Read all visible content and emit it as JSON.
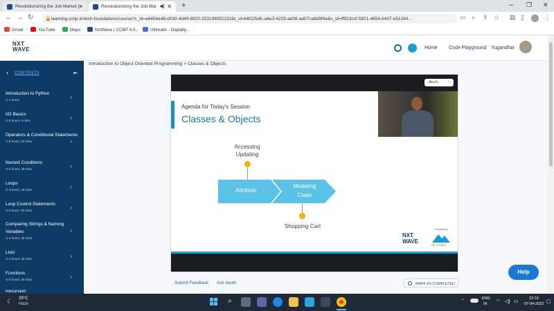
{
  "browser": {
    "tabs": [
      {
        "label": "Revolutionizing the Job Market |"
      },
      {
        "label": "Revolutionizing the Job Mar"
      }
    ],
    "new_tab": "+",
    "url": "learning.ccbp.in/tech-foundations/course?c_id=a6454e48-d030-4d49-8920-253198052232&t_id=b6025dfc-a6e3-4225-ad36-ad07ca8d9f4e&s_id=ff923ccf-5821-4854-b437-e51264...",
    "bookmarks": [
      {
        "label": "Gmail",
        "color": "#ea4335"
      },
      {
        "label": "YouTube",
        "color": "#ff0000"
      },
      {
        "label": "Maps",
        "color": "#34a853"
      },
      {
        "label": "NxtWave | CCBP 4.0...",
        "color": "#1f4c8f"
      },
      {
        "label": "Ultimatix - Digitally...",
        "color": "#4a6ee0"
      }
    ]
  },
  "header": {
    "logo_line1": "NXT",
    "logo_line2": "WAVE",
    "home": "Home",
    "code_playground": "Code Playground",
    "username": "Yugandhar"
  },
  "sidebar": {
    "contents_label": "CONTENTS",
    "items": [
      {
        "title": "Introduction to Python",
        "duration": "4 hours"
      },
      {
        "title": "I/O Basics",
        "duration": "5 hours, 5 mins"
      },
      {
        "title": "Operators & Conditional Statements",
        "duration": "8 hours, 20 mins"
      },
      {
        "title": "Nested Conditions",
        "duration": "5 hours, 35 mins"
      },
      {
        "title": "Loops",
        "duration": "9 hours, 15 mins"
      },
      {
        "title": "Loop Control Statements",
        "duration": "8 hours, 50 mins"
      },
      {
        "title": "Comparing Strings & Naming Variables",
        "duration": "4 hours, 45 mins"
      },
      {
        "title": "Lists",
        "duration": "3 hours, 40 mins"
      },
      {
        "title": "Functions",
        "duration": "8 hours, 50 mins"
      },
      {
        "title": "Recursion",
        "duration": ""
      }
    ]
  },
  "main": {
    "breadcrumb": "Introduction to Object Oriented Programming > Classes & Objects",
    "video": {
      "language": "తెలుగు",
      "agenda": "Agenda for Today's Session",
      "title": "Classes & Objects",
      "accessing": "Accessing",
      "updating": "Updating",
      "attribute": "Attribute",
      "modeling": "Modeling",
      "class": "Class",
      "shopping_cart": "Shopping Cart",
      "logo_line1": "NXT",
      "logo_line2": "WAVE",
      "powered_by": "Powered by",
      "ib_hubs": "IB HUBS"
    },
    "submit_feedback": "Submit Feedback",
    "ask_doubt": "Ask doubt",
    "mark_completed": "MARK AS COMPLETED",
    "help": "Help"
  },
  "taskbar": {
    "temperature": "29°C",
    "weather": "Haze",
    "lang1": "ENG",
    "lang2": "IN",
    "time": "22:19",
    "date": "07-04-2022"
  }
}
